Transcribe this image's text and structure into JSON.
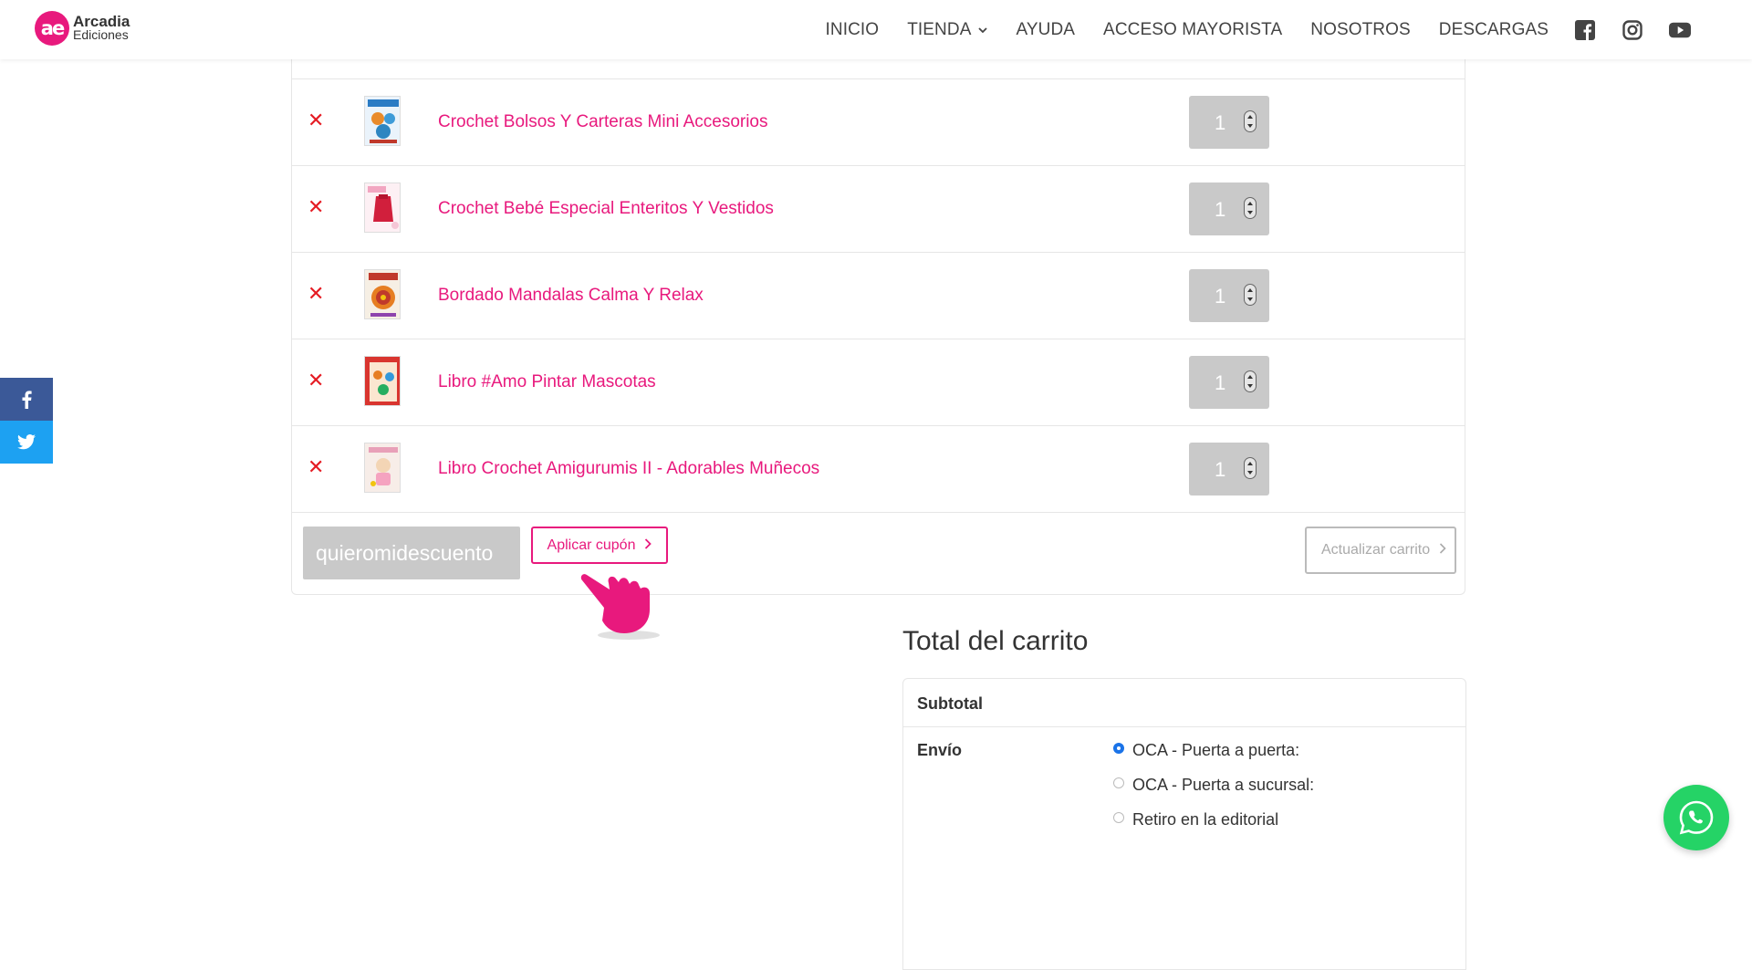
{
  "brand": {
    "logo_mark": "ae",
    "name": "Arcadia",
    "sub": "Ediciones",
    "accent": "#e8197d"
  },
  "nav": {
    "items": [
      "INICIO",
      "TIENDA",
      "AYUDA",
      "ACCESO MAYORISTA",
      "NOSOTROS",
      "DESCARGAS"
    ],
    "social_icons": [
      "facebook-icon",
      "instagram-icon",
      "youtube-icon"
    ]
  },
  "cart": {
    "items": [
      {
        "name": "Crochet Bolsos Y Carteras Mini Accesorios",
        "qty": "1"
      },
      {
        "name": "Crochet Bebé Especial Enteritos Y Vestidos",
        "qty": "1"
      },
      {
        "name": "Bordado Mandalas Calma Y Relax",
        "qty": "1"
      },
      {
        "name": "Libro #Amo Pintar Mascotas",
        "qty": "1"
      },
      {
        "name": "Libro Crochet Amigurumis II - Adorables Muñecos",
        "qty": "1"
      }
    ],
    "coupon_value": "quieromidescuento",
    "apply_label": "Aplicar cupón",
    "update_label": "Actualizar carrito"
  },
  "totals": {
    "title": "Total del carrito",
    "subtotal_label": "Subtotal",
    "shipping_label": "Envío",
    "shipping_options": [
      {
        "label": "OCA - Puerta a puerta:",
        "selected": true
      },
      {
        "label": "OCA - Puerta a sucursal:",
        "selected": false
      },
      {
        "label": "Retiro en la editorial",
        "selected": false
      }
    ]
  },
  "share": [
    "facebook-icon",
    "twitter-icon"
  ],
  "chat": "whatsapp-icon"
}
